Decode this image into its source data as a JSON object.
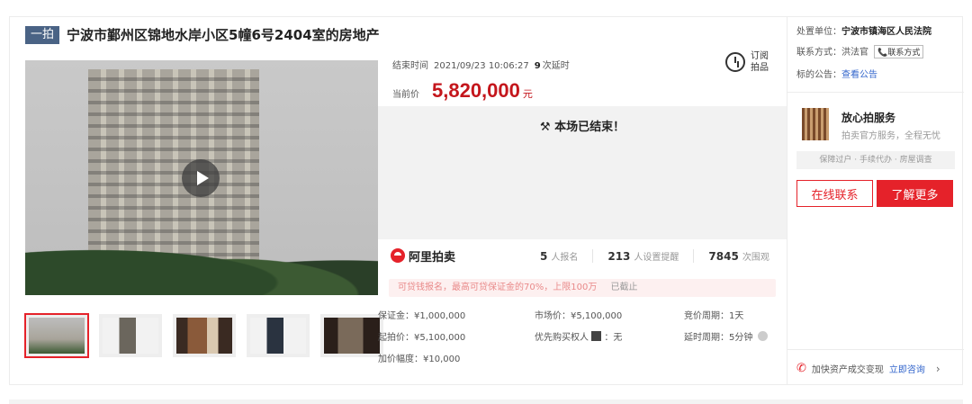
{
  "header": {
    "tag": "一拍",
    "title": "宁波市鄞州区锦地水岸小区5幢6号2404室的房地产"
  },
  "auction": {
    "end_time_label": "结束时间",
    "end_time": "2021/09/23 10:06:27",
    "delay_count": "9",
    "delay_label": "次延时",
    "current_price_label": "当前价",
    "current_price": "5,820,000",
    "currency_unit": "元",
    "subscribe_line1": "订阅",
    "subscribe_line2": "拍品",
    "ended_text": "本场已结束！"
  },
  "stats": {
    "platform": "阿里拍卖",
    "signups": "5",
    "signups_label": "人报名",
    "reminders": "213",
    "reminders_label": "人设置提醒",
    "views": "7845",
    "views_label": "次围观"
  },
  "notice": {
    "text": "可贷钱报名，最高可贷保证金的70%，上限100万",
    "status": "已截止"
  },
  "facts": {
    "deposit": "保证金：¥1,000,000",
    "market_price": "市场价：¥5,100,000",
    "bid_period": "竞价周期：1天",
    "start_price": "起拍价：¥5,100,000",
    "priority": "优先购买权人",
    "priority_value": "：无",
    "delay_period": "延时周期：5分钟",
    "increment": "加价幅度：¥10,000"
  },
  "right": {
    "court_label": "处置单位：",
    "court": "宁波市镇海区人民法院",
    "contact_label": "联系方式：",
    "contact_name": "洪法官",
    "contact_button": "联系方式",
    "announce_label": "标的公告：",
    "announce_link": "查看公告",
    "service_title": "放心拍服务",
    "service_sub": "拍卖官方服务，全程无忧",
    "service_tags": "保障过户 · 手续代办 · 房屋调查",
    "btn_online": "在线联系",
    "btn_more": "了解更多",
    "footer_text": "加快资产成交变现",
    "footer_link": "立即咨询"
  },
  "colors": {
    "accent": "#e5222a",
    "price": "#c4161c",
    "tag_bg": "#4a6385",
    "link": "#3366cc"
  }
}
